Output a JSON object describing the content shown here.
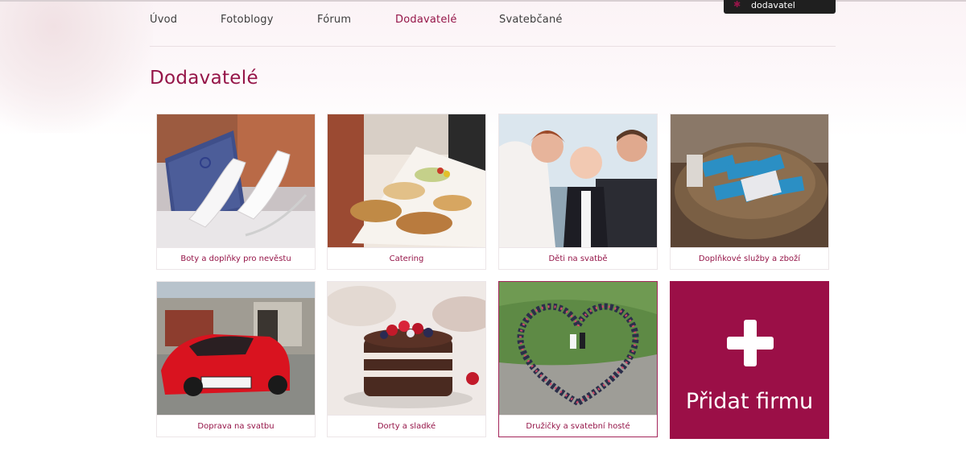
{
  "nav": {
    "items": [
      {
        "label": "Úvod",
        "active": false
      },
      {
        "label": "Fotoblogy",
        "active": false
      },
      {
        "label": "Fórum",
        "active": false
      },
      {
        "label": "Dodavatelé",
        "active": true
      },
      {
        "label": "Svatebčané",
        "active": false
      }
    ]
  },
  "account": {
    "label": "dodavatel",
    "icon": "star-icon"
  },
  "page": {
    "title": "Dodavatelé"
  },
  "categories": [
    {
      "label": "Boty a doplňky pro nevěstu",
      "image": "bridal-shoes-photo"
    },
    {
      "label": "Catering",
      "image": "buffet-photo"
    },
    {
      "label": "Děti na svatbě",
      "image": "wedding-couple-baby-photo"
    },
    {
      "label": "Doplňkové služby a zboží",
      "image": "gift-basket-photo"
    },
    {
      "label": "Doprava na svatbu",
      "image": "red-sports-car-photo"
    },
    {
      "label": "Dorty a sladké",
      "image": "chocolate-cake-photo"
    },
    {
      "label": "Družičky a svatební hosté",
      "image": "wedding-guests-heart-photo"
    }
  ],
  "add_company": {
    "label": "Přidat firmu",
    "icon": "plus-icon"
  },
  "colors": {
    "accent": "#951548",
    "add_tile": "#9b0f47",
    "text": "#3d3d3d"
  }
}
